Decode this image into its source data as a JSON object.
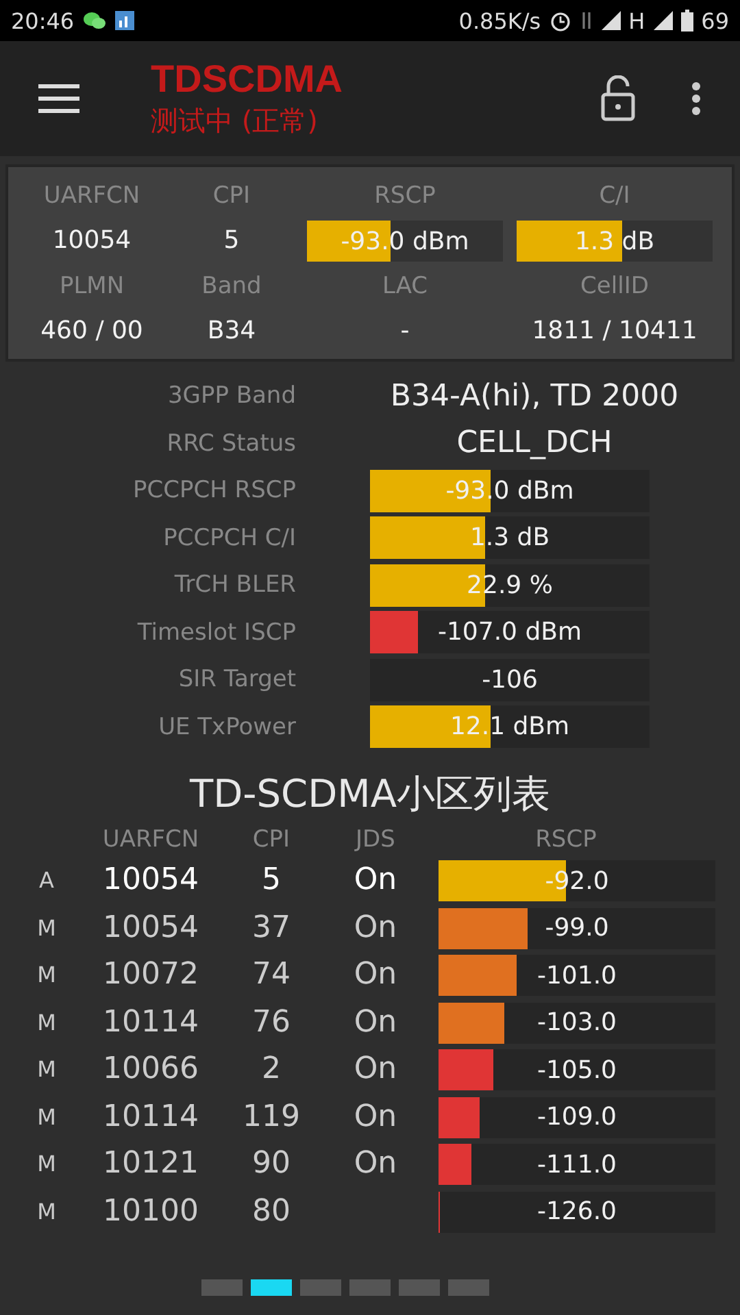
{
  "status_bar": {
    "time": "20:46",
    "speed": "0.85K/s",
    "network": "H",
    "battery": "69"
  },
  "app_bar": {
    "title": "TDSCDMA",
    "subtitle": "测试中 (正常)"
  },
  "summary": {
    "headers": [
      "UARFCN",
      "CPI",
      "RSCP",
      "C/I"
    ],
    "uarfcn": "10054",
    "cpi": "5",
    "rscp": {
      "text": "-93.0 dBm",
      "level": 0.43
    },
    "ci": {
      "text": "1.3 dB",
      "level": 0.54
    },
    "headers2": [
      "PLMN",
      "Band",
      "LAC",
      "CellID"
    ],
    "values2": [
      "460 / 00",
      "B34",
      "-",
      "1811 / 10411"
    ]
  },
  "details": [
    {
      "label": "3GPP Band",
      "kind": "text",
      "value": "B34-A(hi), TD 2000"
    },
    {
      "label": "RRC Status",
      "kind": "text",
      "value": "CELL_DCH"
    },
    {
      "label": "PCCPCH RSCP",
      "kind": "bar",
      "value": "-93.0 dBm",
      "level": 0.43,
      "color": "#e6b000"
    },
    {
      "label": "PCCPCH C/I",
      "kind": "bar",
      "value": "1.3 dB",
      "level": 0.41,
      "color": "#e6b000"
    },
    {
      "label": "TrCH BLER",
      "kind": "bar",
      "value": "22.9 %",
      "level": 0.41,
      "color": "#e6b000"
    },
    {
      "label": "Timeslot ISCP",
      "kind": "bar",
      "value": "-107.0 dBm",
      "level": 0.17,
      "color": "#e03535"
    },
    {
      "label": "SIR Target",
      "kind": "bar",
      "value": "-106"
    },
    {
      "label": "UE TxPower",
      "kind": "bar",
      "value": "12.1 dBm",
      "level": 0.43,
      "color": "#e6b000"
    }
  ],
  "cell_list": {
    "title": "TD-SCDMA小区列表",
    "columns": [
      "UARFCN",
      "CPI",
      "JDS",
      "RSCP"
    ],
    "rows": [
      {
        "type": "A",
        "uarfcn": "10054",
        "cpi": "5",
        "jds": "On",
        "rscp": "-92.0",
        "level": 0.46,
        "color": "#e6b000"
      },
      {
        "type": "M",
        "uarfcn": "10054",
        "cpi": "37",
        "jds": "On",
        "rscp": "-99.0",
        "level": 0.32,
        "color": "#e07020"
      },
      {
        "type": "M",
        "uarfcn": "10072",
        "cpi": "74",
        "jds": "On",
        "rscp": "-101.0",
        "level": 0.28,
        "color": "#e07020"
      },
      {
        "type": "M",
        "uarfcn": "10114",
        "cpi": "76",
        "jds": "On",
        "rscp": "-103.0",
        "level": 0.24,
        "color": "#e07020"
      },
      {
        "type": "M",
        "uarfcn": "10066",
        "cpi": "2",
        "jds": "On",
        "rscp": "-105.0",
        "level": 0.2,
        "color": "#e03535"
      },
      {
        "type": "M",
        "uarfcn": "10114",
        "cpi": "119",
        "jds": "On",
        "rscp": "-109.0",
        "level": 0.15,
        "color": "#e03535"
      },
      {
        "type": "M",
        "uarfcn": "10121",
        "cpi": "90",
        "jds": "On",
        "rscp": "-111.0",
        "level": 0.12,
        "color": "#e03535"
      },
      {
        "type": "M",
        "uarfcn": "10100",
        "cpi": "80",
        "rscp": "-126.0",
        "level": 0.005,
        "color": "#e03535"
      }
    ]
  },
  "pages": [
    {
      "selected": false
    },
    {
      "selected": true
    },
    {
      "selected": false
    },
    {
      "selected": false
    },
    {
      "selected": false
    },
    {
      "selected": false
    }
  ]
}
